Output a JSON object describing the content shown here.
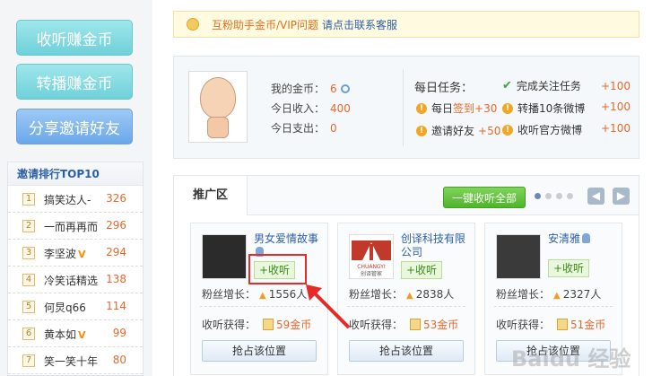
{
  "sidebar": {
    "buttons": [
      {
        "label": "收听赚金币"
      },
      {
        "label": "转播赚金币"
      },
      {
        "label": "分享邀请好友"
      }
    ],
    "ranking": {
      "title": "邀请排行TOP10",
      "rows": [
        {
          "rank": "1",
          "name": "搞笑达人-",
          "score": "326",
          "vip": ""
        },
        {
          "rank": "2",
          "name": "一而再再而",
          "score": "296",
          "vip": ""
        },
        {
          "rank": "3",
          "name": "李坚波",
          "score": "294",
          "vip": "V"
        },
        {
          "rank": "4",
          "name": "冷笑话精选",
          "score": "138",
          "vip": ""
        },
        {
          "rank": "5",
          "name": "何炅q66",
          "score": "114",
          "vip": ""
        },
        {
          "rank": "6",
          "name": "黄本如",
          "score": "99",
          "vip": "V"
        },
        {
          "rank": "7",
          "name": "笑一笑十年",
          "score": "80",
          "vip": ""
        }
      ]
    }
  },
  "notice": {
    "text": "互粉助手金币/VIP问题",
    "link": "请点击联系客服"
  },
  "stats": {
    "coins_label": "我的金币：",
    "coins_value": "6",
    "income_label": "今日收入：",
    "income_value": "400",
    "expense_label": "今日支出：",
    "expense_value": "0"
  },
  "tasks": {
    "title": "每日任务：",
    "items": [
      {
        "label": "完成关注任务",
        "reward": "+100",
        "status": "done"
      },
      {
        "label": "每日",
        "link": "签到",
        "reward": "+30",
        "status": "pending"
      },
      {
        "label": "转播10条微博",
        "reward": "+100",
        "status": "pending"
      },
      {
        "label": "邀请好友",
        "reward": "+50",
        "status": "pending"
      },
      {
        "label": "收听官方微博",
        "reward": "+100",
        "status": "pending"
      }
    ]
  },
  "promo": {
    "tab": "推广区",
    "follow_all": "一键收听全部",
    "prev_icon": "◀",
    "next_icon": "▶",
    "cards": [
      {
        "name": "男女爱情故事",
        "follow": "+收听",
        "fans_label": "粉丝增长：",
        "fans": "1556人",
        "gain_label": "收听获得：",
        "coins": "59金币",
        "grab": "抢占该位置"
      },
      {
        "name": "创译科技有限公司",
        "follow": "+收听",
        "fans_label": "粉丝增长：",
        "fans": "2838人",
        "gain_label": "收听获得：",
        "coins": "53金币",
        "grab": "抢占该位置"
      },
      {
        "name": "安清雅",
        "follow": "+收听",
        "fans_label": "粉丝增长：",
        "fans": "2327人",
        "gain_label": "收听获得：",
        "coins": "51金币",
        "grab": "抢占该位置"
      }
    ],
    "logo_text": "CHUANGYI",
    "logo_caption": "创译管家"
  },
  "watermark": "Baidu 经验",
  "colors": {
    "accent_orange": "#e8682a",
    "link_blue": "#2c5fa8",
    "highlight_red": "#e62a2a",
    "green": "#4fb52b"
  }
}
